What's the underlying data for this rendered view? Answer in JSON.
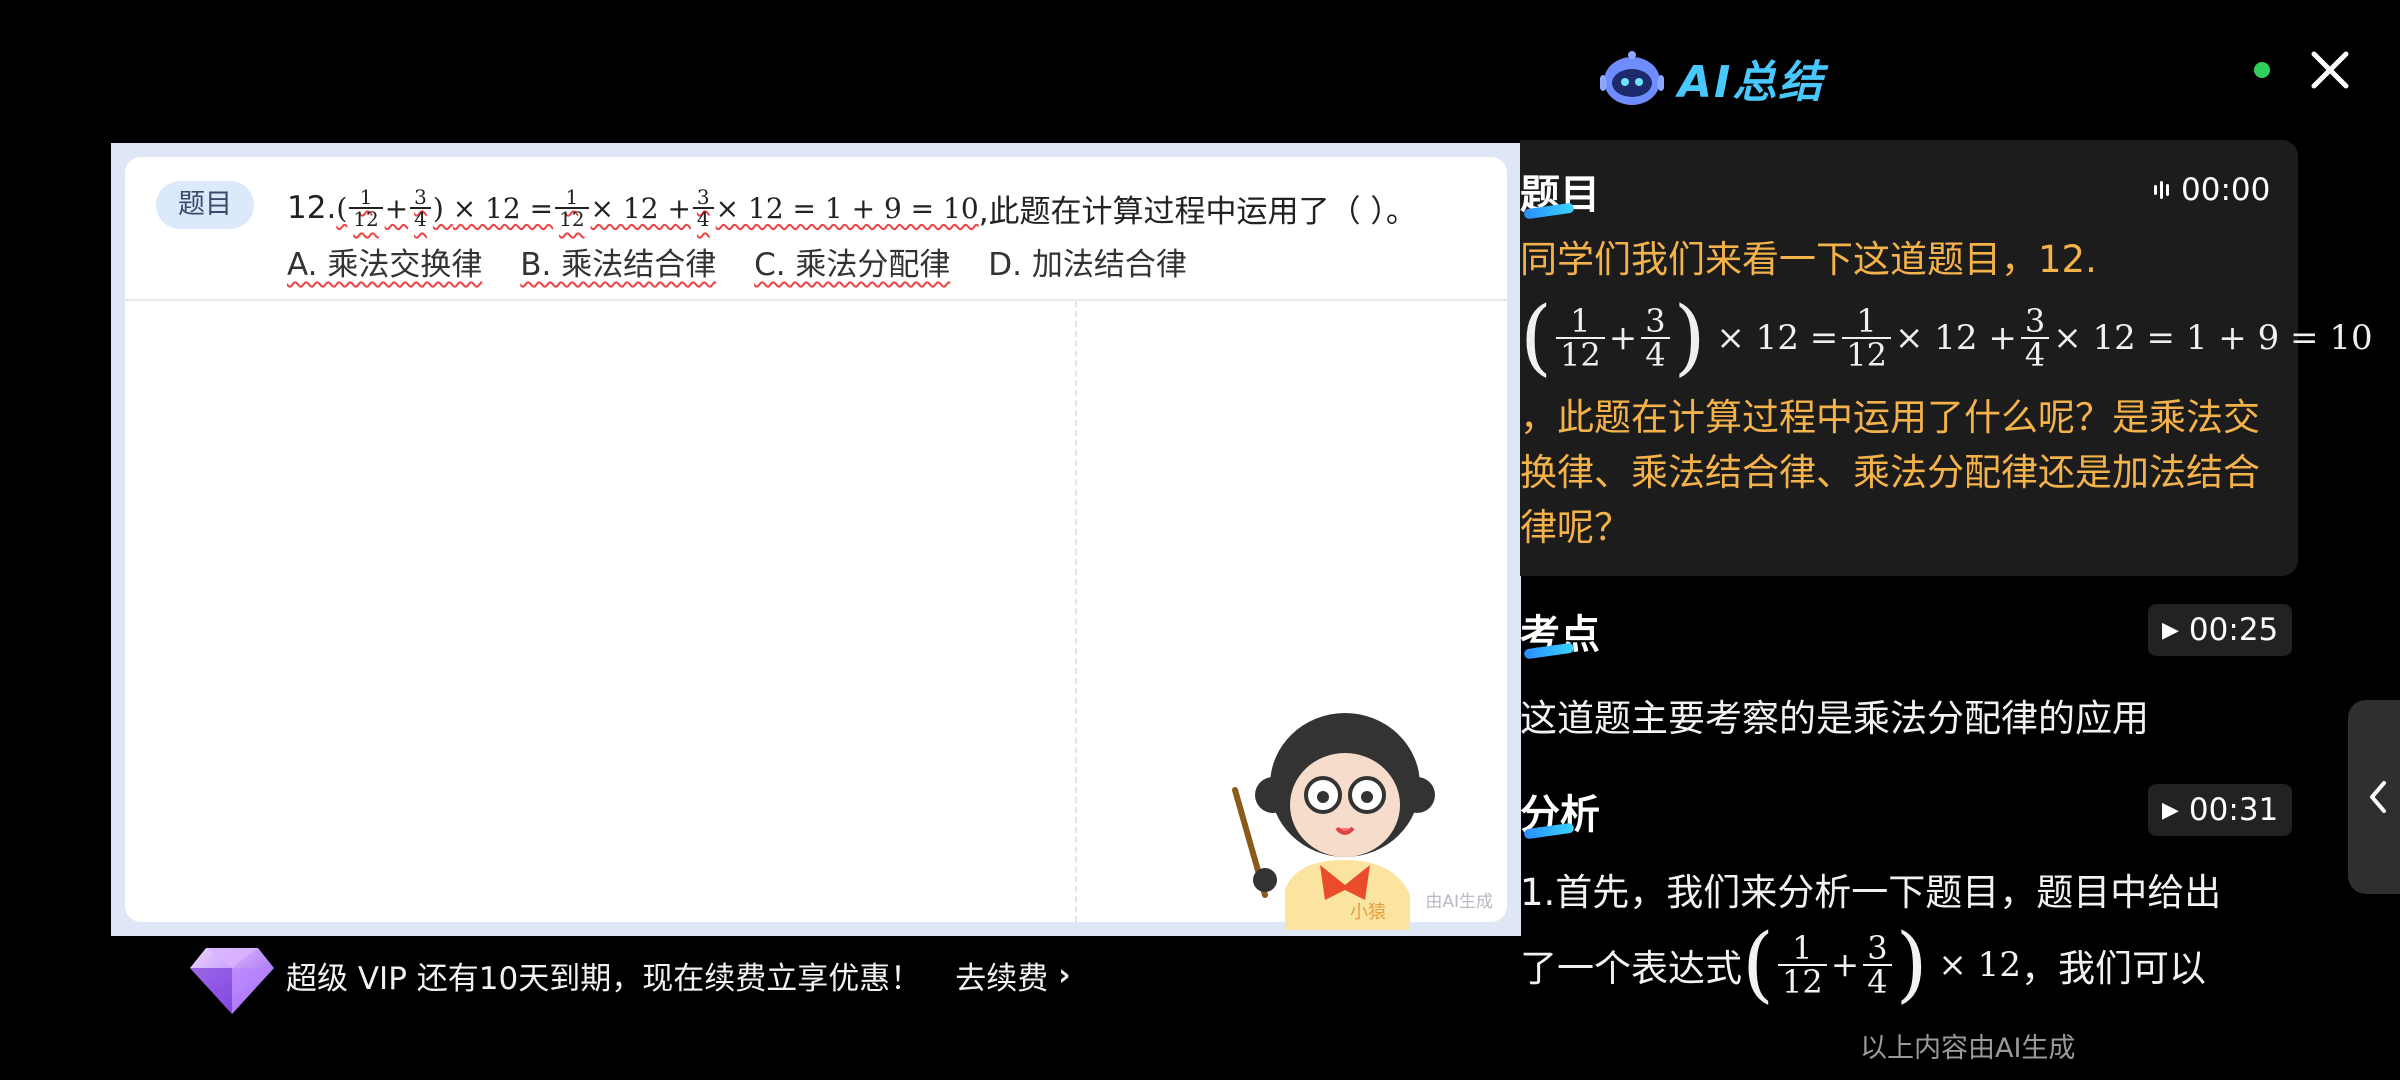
{
  "question": {
    "tag": "题目",
    "number": "12.",
    "stem_suffix": ",此题在计算过程中运用了（    ）。",
    "math": {
      "f1_num": "1",
      "f1_den": "12",
      "plus": "+",
      "f2_num": "3",
      "f2_den": "4",
      "times12": "× 12 =",
      "f3_num": "1",
      "f3_den": "12",
      "mid": "× 12 +",
      "f4_num": "3",
      "f4_den": "4",
      "tail": "× 12 = 1 + 9 = 10"
    },
    "options": [
      "A. 乘法交换律",
      "B. 乘法结合律",
      "C. 乘法分配律",
      "D. 加法结合律"
    ],
    "ai_generated_mark": "由AI生成",
    "mascot_label": "小猿"
  },
  "vip": {
    "text": "超级 VIP 还有10天到期，现在续费立享优惠！",
    "renew": "去续费",
    "renew_icon": "chevron-right-icon"
  },
  "summary": {
    "title": "AI总结",
    "status_color": "#2fcf5b",
    "accent_color": "#49c8ff",
    "highlight_color": "#f4b24a",
    "sections": {
      "topic": {
        "title": "题目",
        "time": "00:00",
        "text_line1": "同学们我们来看一下这道题目，12.",
        "math": {
          "f1_num": "1",
          "f1_den": "12",
          "plus": "+",
          "f2_num": "3",
          "f2_den": "4",
          "times12": "× 12 =",
          "f3_num": "1",
          "f3_den": "12",
          "mid": "× 12 +",
          "f4_num": "3",
          "f4_den": "4",
          "tail": "× 12 = 1 + 9 = 10"
        },
        "text_rest": "，此题在计算过程中运用了什么呢？是乘法交换律、乘法结合律、乘法分配律还是加法结合律呢？"
      },
      "exam_point": {
        "title": "考点",
        "time": "00:25",
        "text": "这道题主要考察的是乘法分配律的应用"
      },
      "analysis": {
        "title": "分析",
        "time": "00:31",
        "text_line1": "1.首先，我们来分析一下题目，题目中给出",
        "text_line2_prefix": "了一个表达式",
        "math": {
          "f1_num": "1",
          "f1_den": "12",
          "plus": "+",
          "f2_num": "3",
          "f2_den": "4",
          "times12": "× 12"
        },
        "text_line2_suffix": "，我们可以"
      }
    },
    "footer_note": "以上内容由AI生成"
  }
}
